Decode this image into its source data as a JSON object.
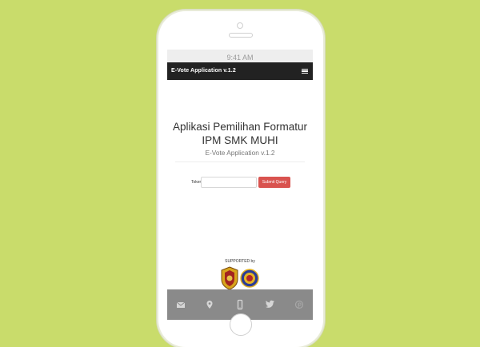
{
  "status_bar": {
    "time": "9:41 AM"
  },
  "navbar": {
    "brand": "E-Vote Application v.1.2",
    "menu_icon": "hamburger-menu-icon"
  },
  "main": {
    "title": "Aplikasi Pemilihan Formatur IPM SMK MUHI",
    "subtitle": "E-Vote Application v.1.2"
  },
  "form": {
    "token_label": "Token",
    "token_value": "",
    "submit_label": "Submit Query"
  },
  "supported": {
    "label": "SUPPORTED by",
    "logos": [
      "school-emblem-logo",
      "organization-emblem-logo"
    ]
  },
  "footer": {
    "icons": [
      "mail-icon",
      "location-pin-icon",
      "mobile-phone-icon",
      "twitter-icon",
      "pinterest-icon"
    ]
  },
  "colors": {
    "background": "#c9dc6b",
    "navbar": "#222222",
    "submit_button": "#d9534f",
    "footer": "#8a8a8a"
  }
}
